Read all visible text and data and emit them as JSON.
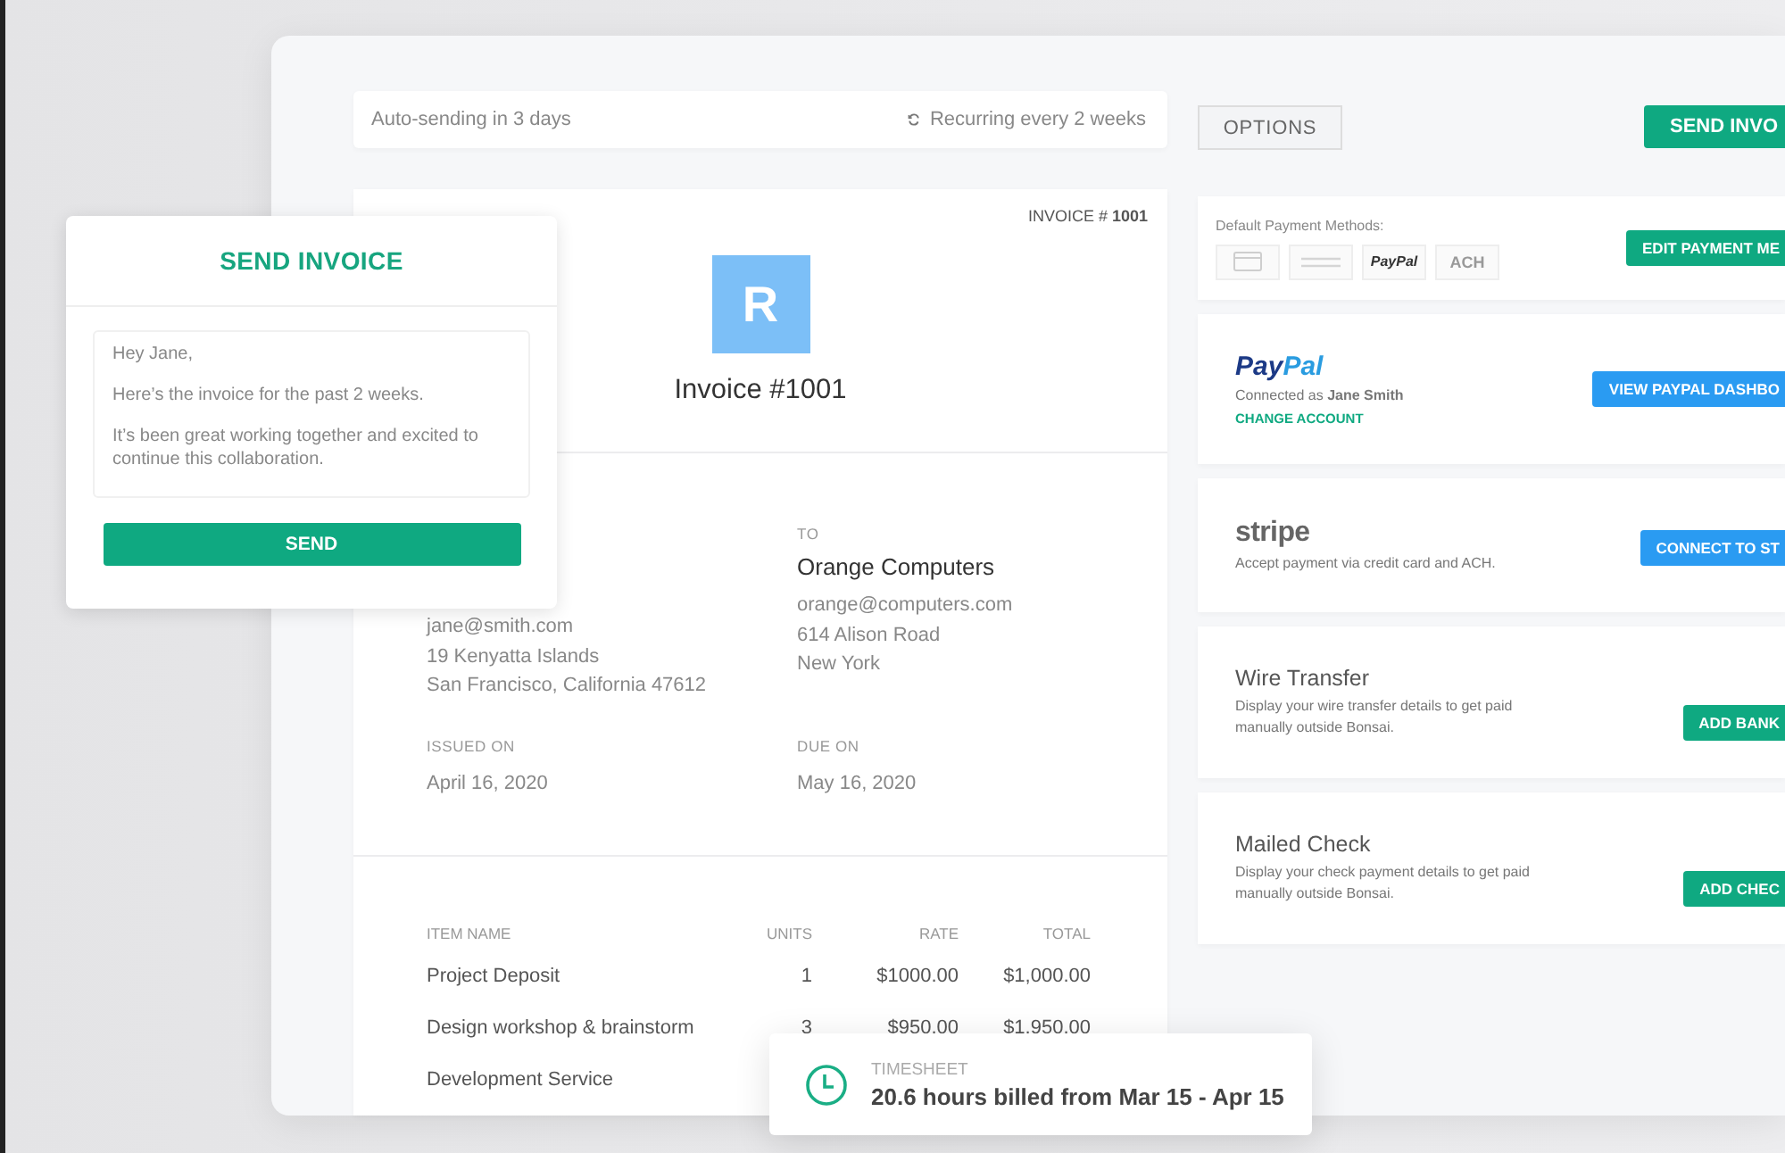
{
  "top_bar": {
    "auto_sending": "Auto-sending in 3 days",
    "recurring": "Recurring every 2 weeks"
  },
  "invoice": {
    "number_label": "INVOICE # **1001**",
    "logo_letter": "R",
    "title": "Invoice #1001",
    "from_lines": [
      "jane@smith.com",
      "19 Kenyatta Islands",
      "San Francisco, California  47612"
    ],
    "to": {
      "label": "TO",
      "name": "Orange Computers",
      "lines": [
        "orange@computers.com",
        "614 Alison Road",
        "New York"
      ]
    },
    "issued": {
      "label": "ISSUED ON",
      "date": "April 16, 2020"
    },
    "due": {
      "label": "DUE ON",
      "date": "May 16, 2020"
    },
    "items": {
      "columns": [
        "ITEM NAME",
        "UNITS",
        "RATE",
        "TOTAL"
      ],
      "rows": [
        [
          "Project Deposit",
          "1",
          "$1000.00",
          "$1,000.00"
        ],
        [
          "Design workshop & brainstorm",
          "3",
          "$950.00",
          "$1,950.00"
        ],
        [
          "Development Service"
        ]
      ]
    }
  },
  "timesheet": {
    "label": "TIMESHEET",
    "text": "20.6 hours billed from Mar 15 - Apr 15"
  },
  "send_dialog": {
    "title": "SEND INVOICE",
    "message": [
      "Hey Jane,",
      "Here’s the invoice for the past 2 weeks.",
      "It’s been great working together and excited to continue this collaboration."
    ],
    "button": "SEND"
  },
  "options_button": "OPTIONS",
  "send_button": "SEND INVO",
  "payment_methods": {
    "label": "Default Payment Methods:",
    "button": "EDIT PAYMENT ME",
    "methods": [
      {
        "kind": "card",
        "enabled": false
      },
      {
        "kind": "bank",
        "enabled": false
      },
      {
        "kind": "text",
        "text": "PayPal",
        "enabled": true
      },
      {
        "kind": "text",
        "text": "ACH",
        "enabled": false
      }
    ]
  },
  "providers": [
    {
      "kind": "paypal",
      "logo": [
        "Pay",
        "Pal"
      ],
      "lines": [
        "Connected as **Jane Smith**"
      ],
      "link": "CHANGE ACCOUNT",
      "button": {
        "text": "VIEW PAYPAL DASHBO",
        "color": "#2a9bf2"
      }
    },
    {
      "kind": "stripe",
      "logo": [
        "stripe"
      ],
      "lines": [
        "Accept payment via credit card and ACH."
      ],
      "button": {
        "text": "CONNECT TO ST",
        "color": "#2a9bf2"
      }
    },
    {
      "kind": "title",
      "logo": [
        "Wire Transfer"
      ],
      "lines": [
        "Display your wire transfer details to get paid",
        "manually outside Bonsai."
      ],
      "button": {
        "text": "ADD BANK",
        "color": "#0fa981"
      }
    },
    {
      "kind": "title",
      "logo": [
        "Mailed Check"
      ],
      "lines": [
        "Display your check payment details to get paid",
        "manually outside Bonsai."
      ],
      "button": {
        "text": "ADD CHEC",
        "color": "#0fa981"
      }
    }
  ]
}
